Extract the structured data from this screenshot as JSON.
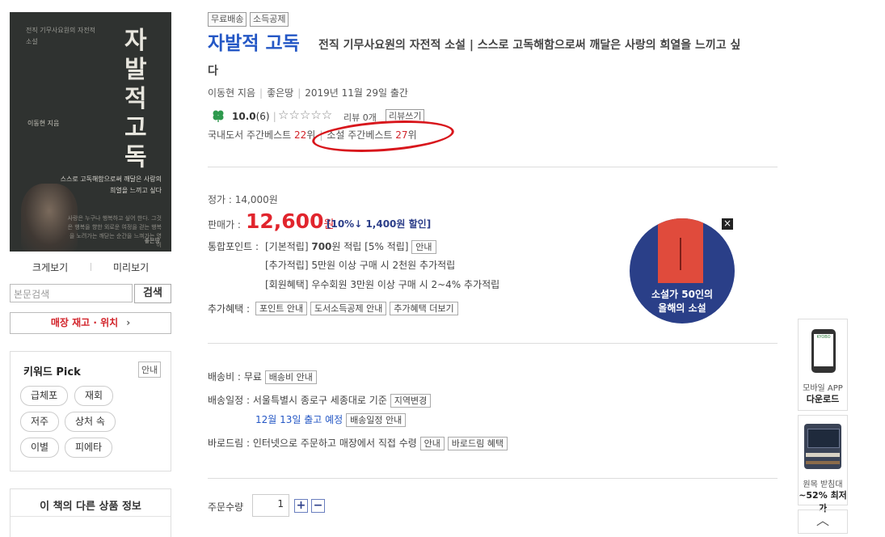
{
  "book": {
    "cover": {
      "title_vertical": "자발적 고독",
      "tagline": "전직 기무사요원의 자전적 소설",
      "author": "이동현 지음",
      "quote": "스스로 고독해함으로써 깨달은 사랑의 희열을 느끼고 싶다",
      "small_text": "사랑은 누구나 행복하고 싶어 한다. 그것은 행복을 향한 외로운 여정을 걷는 행복을 노려가는 깨닫는 순간을 느껴가는 영이",
      "publisher_mark": "좋은땅"
    },
    "badges": [
      "무료배송",
      "소득공제"
    ],
    "title": "자발적 고독",
    "subtitle_1": "전직 기무사요원의 자전적 소설 | 스스로 고독해함으로써 깨달은 사랑의 희열을 느끼고 싶",
    "subtitle_2": "다",
    "author": "이동현 지음",
    "publisher": "좋은땅",
    "pub_date": "2019년 11월 29일 출간",
    "rating_score": "10.0",
    "rating_count": "(6)",
    "stars": "☆☆☆☆☆",
    "review_text": "리뷰 0개",
    "review_btn": "리뷰쓰기",
    "best_domestic_label": "국내도서 주간베스트 ",
    "best_domestic_rank": "22",
    "best_domestic_unit": "위",
    "best_novel_label": "소설 주간베스트 ",
    "best_novel_rank": "27",
    "best_novel_unit": "위"
  },
  "left": {
    "view_large": "크게보기",
    "view_preview": "미리보기",
    "search_placeholder": "본문검색",
    "search_btn": "검색",
    "stock_btn": "매장 재고 · 위치",
    "stock_arrow": "›",
    "keyword_title": "키워드 Pick",
    "keyword_guide": "안내",
    "keywords": [
      "급체포",
      "재회",
      "저주",
      "상처 속",
      "이별",
      "피에타"
    ],
    "other_title": "이 책의 다른 상품 정보"
  },
  "price": {
    "list_price": "정가 : 14,000원",
    "sale_label": "판매가 :",
    "sale_value": "12,600",
    "sale_unit": "원",
    "discount": "[10%↓ 1,400원 할인]",
    "points_label": "통합포인트 :",
    "points_rows": [
      {
        "pre": "[기본적립] ",
        "bold": "700",
        "post": "원 적립 [5% 적립]",
        "btn": "안내"
      },
      {
        "pre": "[추가적립] 5만원 이상 구매 시 2천원 추가적립",
        "bold": "",
        "post": "",
        "btn": ""
      },
      {
        "pre": "[회원혜택] 우수회원 3만원 이상 구매 시 2~4% 추가적립",
        "bold": "",
        "post": "",
        "btn": ""
      }
    ],
    "extra_label": "추가혜택 :",
    "extra_buttons": [
      "포인트 안내",
      "도서소득공제 안내",
      "추가혜택 더보기"
    ]
  },
  "delivery": {
    "fee_label": "배송비 :",
    "fee_value": "무료",
    "fee_btn": "배송비 안내",
    "schedule_label": "배송일정 :",
    "schedule_value": "서울특별시 종로구 세종대로 기준",
    "schedule_btn": "지역변경",
    "ship_date": "12월 13일 출고 예정",
    "ship_btn": "배송일정 안내",
    "baro_label": "바로드림 :",
    "baro_value": "인터넷으로 주문하고 매장에서 직접 수령",
    "baro_btn1": "안내",
    "baro_btn2": "바로드림 혜택"
  },
  "ad": {
    "text_line1": "소설가 50인의",
    "text_line2": "올해의 소설",
    "close": "×"
  },
  "widgets": {
    "app_label1": "모바일 APP",
    "app_label2": "다운로드",
    "app_screen": "KYOBO",
    "desk_label1": "원목 받침대",
    "desk_label2": "~52% 최저가",
    "up": "︿"
  },
  "order": {
    "qty_label": "주문수량",
    "qty_value": "1",
    "plus": "+",
    "minus": "−"
  },
  "colors": {
    "title_blue": "#2457c5",
    "price_red": "#e1252d",
    "highlight_circle": "#d8161c",
    "ad_navy": "#2a3f88"
  }
}
